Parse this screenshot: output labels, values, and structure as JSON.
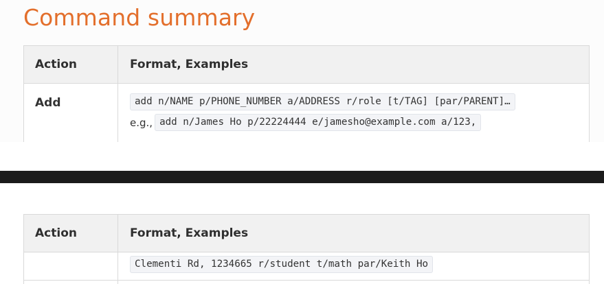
{
  "heading": "Command summary",
  "table": {
    "col_action": "Action",
    "col_format": "Format, Examples"
  },
  "top_row": {
    "action": "Add",
    "format_code": "add n/NAME p/PHONE_NUMBER a/ADDRESS r/role [t/TAG] [par/PARENT]…",
    "example_prefix": "e.g.,",
    "example_code": "add n/James Ho p/22224444 e/jamesho@example.com a/123,"
  },
  "bottom_row": {
    "action": "",
    "continuation_code": "Clementi Rd, 1234665 r/student t/math par/Keith Ho"
  }
}
